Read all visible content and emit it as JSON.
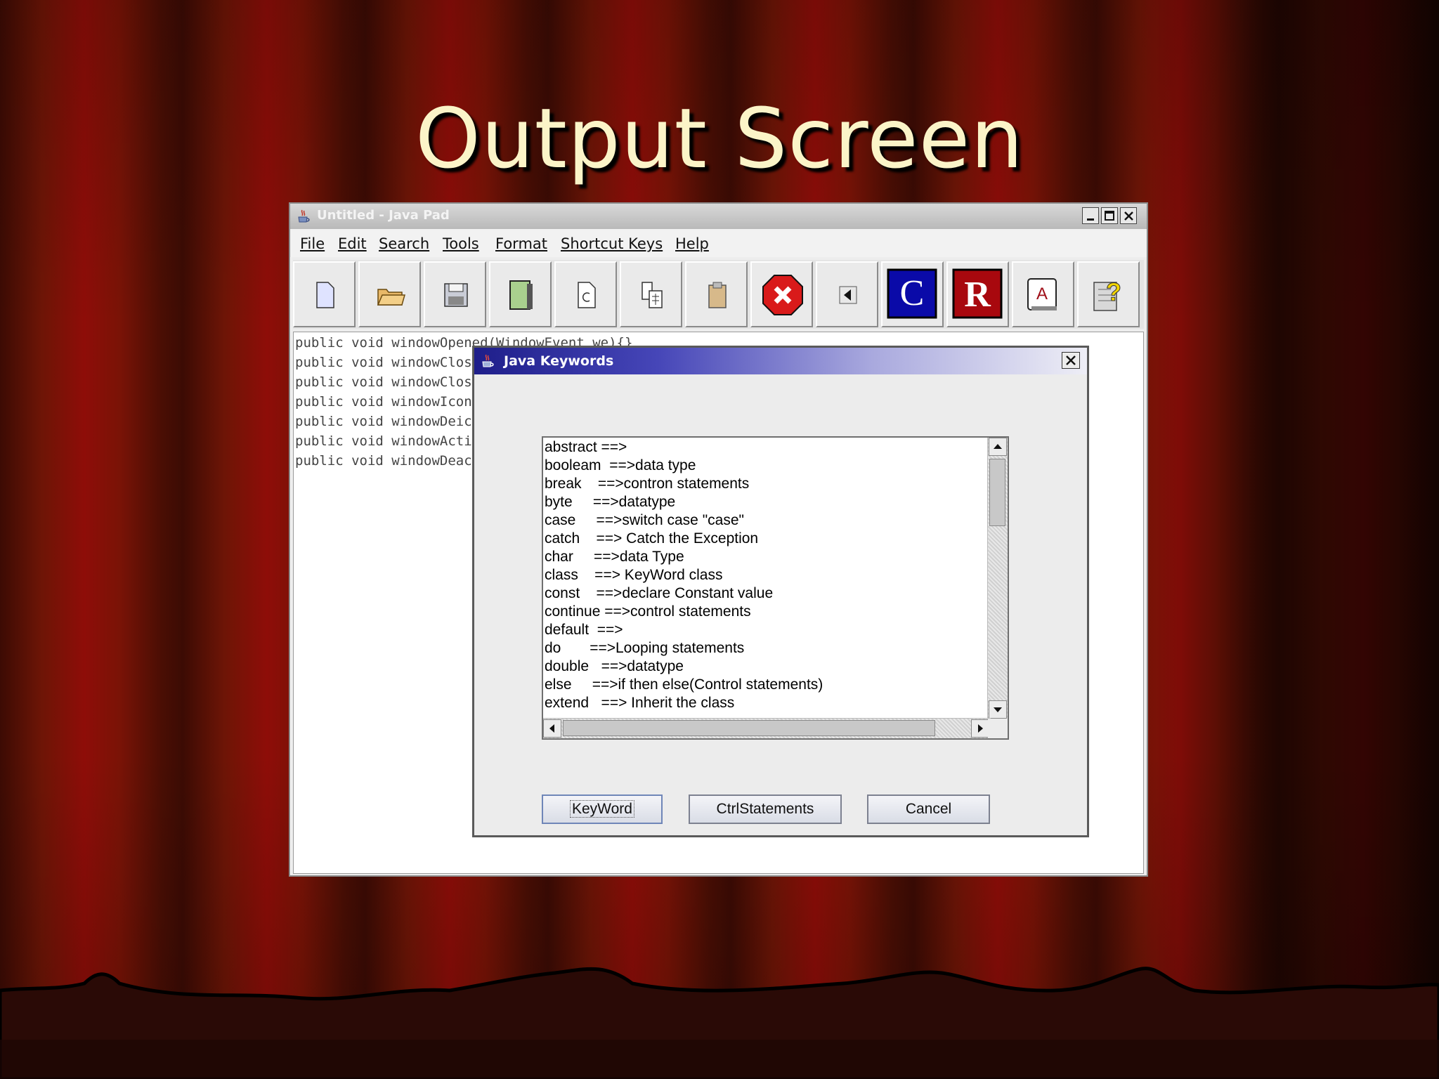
{
  "slide": {
    "title": "Output Screen"
  },
  "app": {
    "window_title": "Untitled - Java Pad",
    "menu": [
      {
        "label": "File"
      },
      {
        "label": "Edit"
      },
      {
        "label": "Search"
      },
      {
        "label": "Tools"
      },
      {
        "label": "Format"
      },
      {
        "label": "Shortcut Keys"
      },
      {
        "label": "Help"
      }
    ],
    "toolbar": [
      {
        "icon": "new-file-icon"
      },
      {
        "icon": "open-folder-icon"
      },
      {
        "icon": "save-disk-icon"
      },
      {
        "icon": "book-icon"
      },
      {
        "icon": "refresh-page-icon"
      },
      {
        "icon": "copy-icon"
      },
      {
        "icon": "paste-clipboard-icon"
      },
      {
        "icon": "close-red-icon"
      },
      {
        "icon": "left-arrow-icon"
      },
      {
        "icon": "c-letter-icon",
        "text": "C"
      },
      {
        "icon": "r-letter-icon",
        "text": "R"
      },
      {
        "icon": "font-a-icon",
        "text": "A"
      },
      {
        "icon": "help-question-icon",
        "text": "?"
      }
    ],
    "editor_lines": [
      "public void windowOpened(WindowEvent we){}",
      "public void windowClosing",
      "public void windowClosed(",
      "public void windowIconified",
      "public void windowDeiconi",
      "public void windowActivated",
      "public void windowDeactiva"
    ]
  },
  "dialog": {
    "title": "Java Keywords",
    "keywords": [
      "abstract ==>",
      "booleam  ==>data type",
      "break    ==>contron statements",
      "byte     ==>datatype",
      "case     ==>switch case \"case\"",
      "catch    ==> Catch the Exception",
      "char     ==>data Type",
      "class    ==> KeyWord class",
      "const    ==>declare Constant value",
      "continue ==>control statements",
      "default  ==>",
      "do       ==>Looping statements",
      "double   ==>datatype",
      "else     ==>if then else(Control statements)",
      "extend   ==> Inherit the class"
    ],
    "buttons": {
      "keyword": "KeyWord",
      "ctrl": "CtrlStatements",
      "cancel": "Cancel"
    }
  }
}
